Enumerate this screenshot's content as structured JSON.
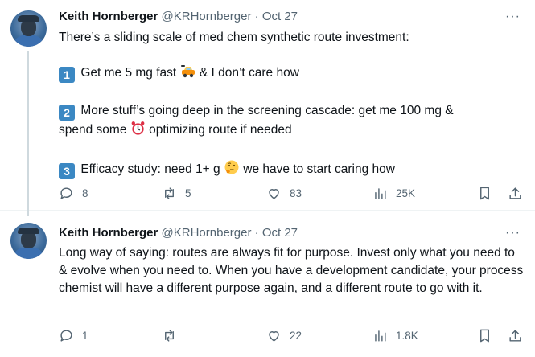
{
  "tweets": [
    {
      "author_name": "Keith Hornberger",
      "handle": "@KRHornberger",
      "separator": "·",
      "date": "Oct 27",
      "more_label": "···",
      "line1": "There’s a sliding scale of med chem synthetic route investment:",
      "item1_num": "1",
      "item1_text_a": "Get me 5 mg fast",
      "item1_text_b": "& I don’t care how",
      "item2_num": "2",
      "item2_text_a": "More stuff’s going deep in the screening cascade: get me 100 mg &",
      "item2_text_b": "spend some",
      "item2_text_c": "optimizing route if needed",
      "item3_num": "3",
      "item3_text_a": "Efficacy study: need 1+ g",
      "item3_text_b": "we have to start caring how",
      "replies": "8",
      "reposts": "5",
      "likes": "83",
      "views": "25K"
    },
    {
      "author_name": "Keith Hornberger",
      "handle": "@KRHornberger",
      "separator": "·",
      "date": "Oct 27",
      "more_label": "···",
      "text": "Long way of saying: routes are always fit for purpose. Invest only what you need to & evolve when you need to. When you have a development candidate, your process chemist will have a different purpose again, and a different route to go with it.",
      "replies": "1",
      "reposts": "",
      "likes": "22",
      "views": "1.8K"
    }
  ],
  "icons": [
    "reply-icon",
    "repost-icon",
    "like-icon",
    "views-icon",
    "bookmark-icon",
    "share-icon",
    "car-emoji-icon",
    "alarm-clock-emoji-icon",
    "thinking-face-emoji-icon"
  ],
  "colors": {
    "text": "#0f1419",
    "secondary": "#536471",
    "divider": "#eff3f4",
    "thread_line": "#cfd9de",
    "keycap": "#3b88c3"
  }
}
